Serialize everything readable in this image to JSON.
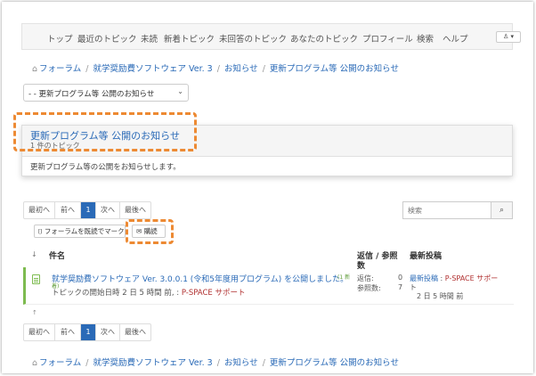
{
  "nav": {
    "items": [
      "トップ",
      "最近のトピック",
      "未読",
      "新着トピック",
      "未回答のトピック",
      "あなたのトピック",
      "プロフィール",
      "検索",
      "ヘルプ"
    ],
    "user_menu": "♙ ▾"
  },
  "breadcrumb": {
    "home_icon": "⌂",
    "items": [
      "フォーラム",
      "就学奨励費ソフトウェア Ver. 3",
      "お知らせ",
      "更新プログラム等 公開のお知らせ"
    ]
  },
  "forum_select": {
    "value": "- - 更新プログラム等 公開のお知らせ",
    "chevron": "⌄"
  },
  "forum": {
    "title": "更新プログラム等 公開のお知らせ",
    "subtitle": "1 件のトピック",
    "description": "更新プログラム等の公開をお知らせします。"
  },
  "pager": {
    "first": "最初へ",
    "prev": "前へ",
    "current": "1",
    "next": "次へ",
    "last": "最後へ"
  },
  "search": {
    "placeholder": "検索",
    "icon": "⌕"
  },
  "actions": {
    "mark_read_icon": "⌷",
    "mark_read": "フォーラムを既読でマーク",
    "subscribe_icon": "✉",
    "subscribe": "購読"
  },
  "table": {
    "sort_icon": "↓",
    "col_subject": "件名",
    "col_stats_line1": "返信 / 参照",
    "col_stats_line2": "数",
    "col_latest": "最新投稿"
  },
  "topic": {
    "title": "就学奨励費ソフトウェア Ver. 3.0.0.1 (令和5年度用プログラム) を公開しました。",
    "badge_line1": "(1 新",
    "badge_line2": "着)",
    "started_prefix": "トピックの開始日時 2 日 5 時間 前, :",
    "author": "P-SPACE サポート",
    "replies_label": "返信:",
    "replies_value": "0",
    "views_label": "参照数:",
    "views_value": "7",
    "latest_label": "最新投稿",
    "latest_sep": ":",
    "latest_author_line1": "P-SPACE サポー",
    "latest_author_line2": "ト",
    "latest_time": "2 日 5 時間 前"
  },
  "back_to_top": "↑",
  "colors": {
    "link": "#2a6ab7",
    "accent_border": "#7dbb4f",
    "highlight": "#ed8a33",
    "author": "#b02f2f"
  }
}
